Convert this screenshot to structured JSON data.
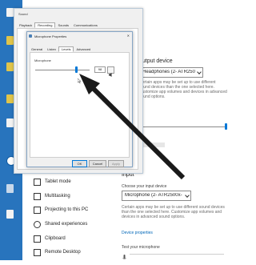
{
  "sound_dialog": {
    "title": "Sound",
    "tabs": [
      "Playback",
      "Recording",
      "Sounds",
      "Communications"
    ]
  },
  "mic_dialog": {
    "title": "Microphone Properties",
    "tabs": [
      "General",
      "Listen",
      "Levels",
      "Advanced"
    ],
    "levels": {
      "label": "Microphone",
      "value": "98",
      "slider_fraction": 0.75
    },
    "buttons": {
      "ok": "OK",
      "cancel": "Cancel",
      "apply": "Apply"
    }
  },
  "settings_right": {
    "output_heading": "output device",
    "output_device": "Headphones (2- ATR2500x-USB M...",
    "output_note": "Certain apps may be set up to use different sound devices than the one selected here. Customize app volumes and devices in advanced sound options.",
    "input_heading": "Input",
    "input_label": "Choose your input device",
    "input_device": "Microphone (2- ATR2500x-USB M...",
    "input_note": "Certain apps may be set up to use different sound devices than the one selected here. Customize app volumes and devices in advanced sound options.",
    "device_properties": "Device properties",
    "test_label": "Test your microphone"
  },
  "settings_nav": {
    "items": [
      {
        "label": "Tablet mode",
        "icon": "tablet-icon"
      },
      {
        "label": "Multitasking",
        "icon": "multitasking-icon"
      },
      {
        "label": "Projecting to this PC",
        "icon": "projector-icon"
      },
      {
        "label": "Shared experiences",
        "icon": "shared-experiences-icon"
      },
      {
        "label": "Clipboard",
        "icon": "clipboard-icon"
      },
      {
        "label": "Remote Desktop",
        "icon": "remote-desktop-icon"
      }
    ]
  },
  "colors": {
    "accent": "#0078d7",
    "desktop": "#2874bd",
    "arrow": "#1a1a1a"
  },
  "annotation": {
    "icon": "arrow-pointer-icon"
  }
}
